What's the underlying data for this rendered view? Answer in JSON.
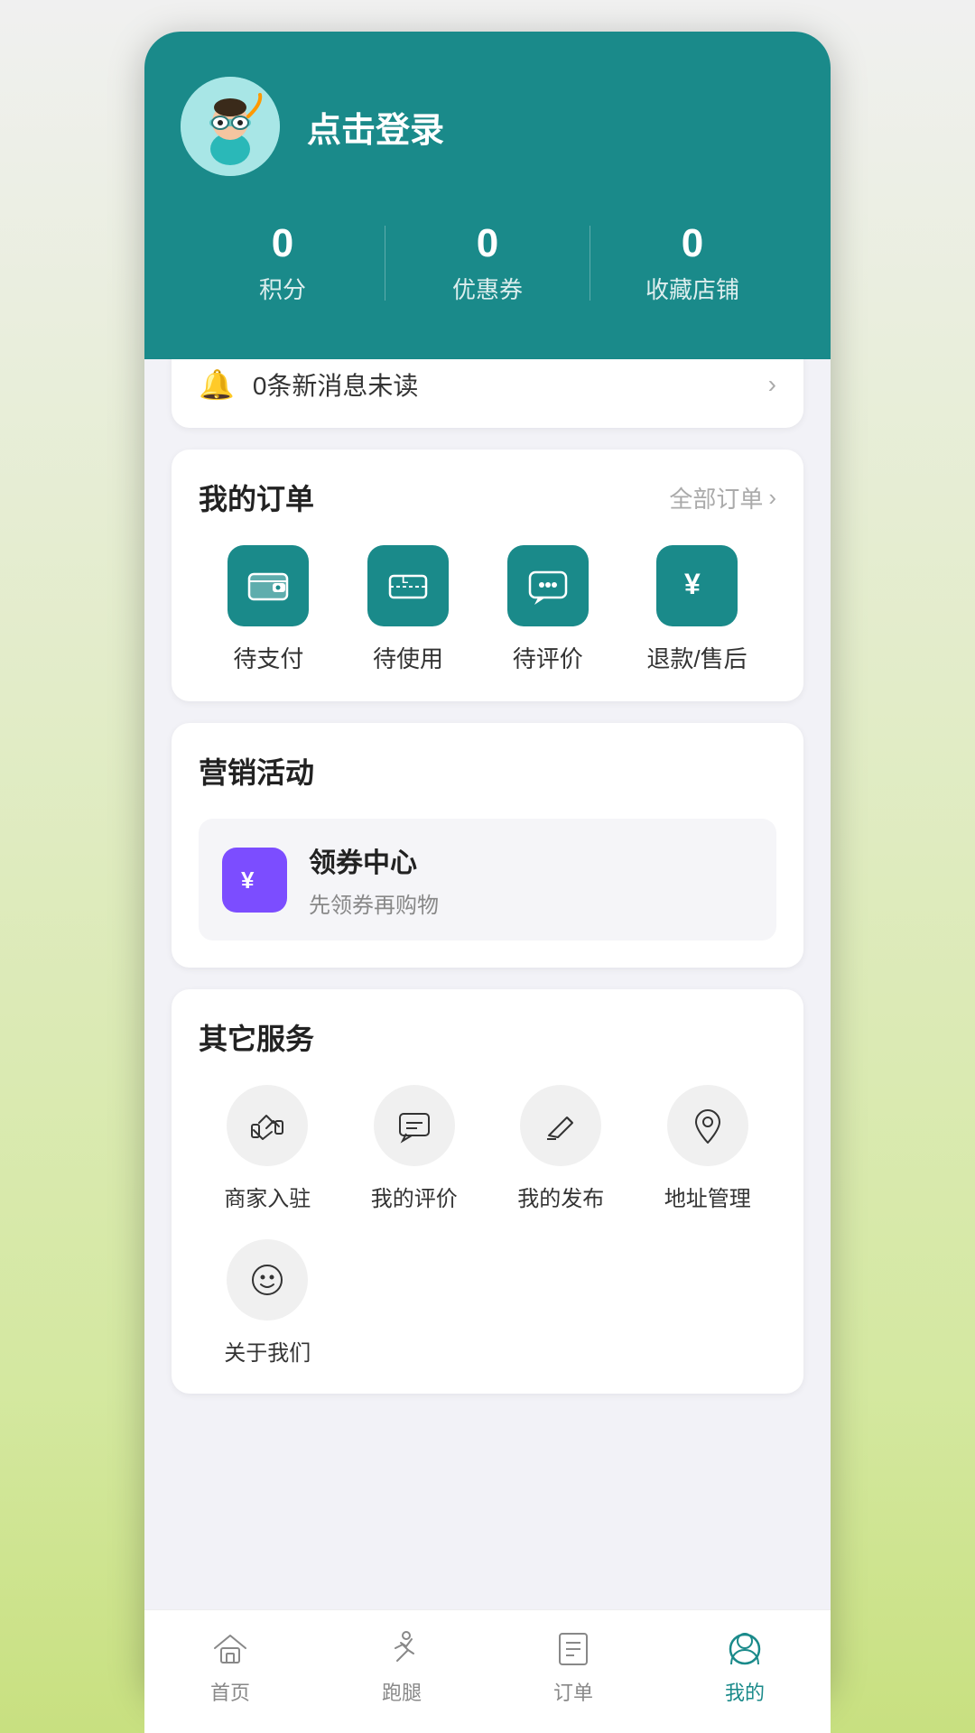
{
  "header": {
    "username": "点击登录",
    "stats": [
      {
        "value": "0",
        "label": "积分"
      },
      {
        "value": "0",
        "label": "优惠券"
      },
      {
        "value": "0",
        "label": "收藏店铺"
      }
    ]
  },
  "notification": {
    "text": "0条新消息未读"
  },
  "orders": {
    "title": "我的订单",
    "all_orders_link": "全部订单",
    "items": [
      {
        "label": "待支付"
      },
      {
        "label": "待使用"
      },
      {
        "label": "待评价"
      },
      {
        "label": "退款/售后"
      }
    ]
  },
  "marketing": {
    "title": "营销活动",
    "items": [
      {
        "title": "领券中心",
        "subtitle": "先领券再购物"
      }
    ]
  },
  "other_services": {
    "title": "其它服务",
    "items": [
      {
        "label": "商家入驻"
      },
      {
        "label": "我的评价"
      },
      {
        "label": "我的发布"
      },
      {
        "label": "地址管理"
      },
      {
        "label": "关于我们"
      }
    ]
  },
  "bottom_nav": {
    "items": [
      {
        "label": "首页",
        "active": false
      },
      {
        "label": "跑腿",
        "active": false
      },
      {
        "label": "订单",
        "active": false
      },
      {
        "label": "我的",
        "active": true
      }
    ]
  }
}
